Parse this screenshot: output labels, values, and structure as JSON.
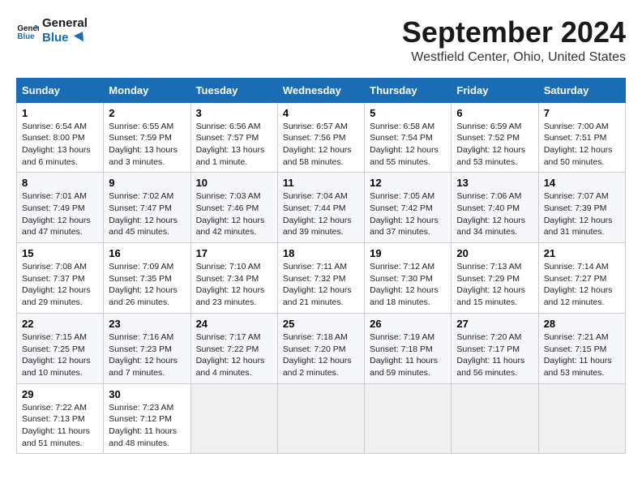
{
  "logo": {
    "line1": "General",
    "line2": "Blue"
  },
  "title": "September 2024",
  "location": "Westfield Center, Ohio, United States",
  "weekdays": [
    "Sunday",
    "Monday",
    "Tuesday",
    "Wednesday",
    "Thursday",
    "Friday",
    "Saturday"
  ],
  "weeks": [
    [
      {
        "day": "1",
        "sunrise": "6:54 AM",
        "sunset": "8:00 PM",
        "daylight": "13 hours and 6 minutes."
      },
      {
        "day": "2",
        "sunrise": "6:55 AM",
        "sunset": "7:59 PM",
        "daylight": "13 hours and 3 minutes."
      },
      {
        "day": "3",
        "sunrise": "6:56 AM",
        "sunset": "7:57 PM",
        "daylight": "13 hours and 1 minute."
      },
      {
        "day": "4",
        "sunrise": "6:57 AM",
        "sunset": "7:56 PM",
        "daylight": "12 hours and 58 minutes."
      },
      {
        "day": "5",
        "sunrise": "6:58 AM",
        "sunset": "7:54 PM",
        "daylight": "12 hours and 55 minutes."
      },
      {
        "day": "6",
        "sunrise": "6:59 AM",
        "sunset": "7:52 PM",
        "daylight": "12 hours and 53 minutes."
      },
      {
        "day": "7",
        "sunrise": "7:00 AM",
        "sunset": "7:51 PM",
        "daylight": "12 hours and 50 minutes."
      }
    ],
    [
      {
        "day": "8",
        "sunrise": "7:01 AM",
        "sunset": "7:49 PM",
        "daylight": "12 hours and 47 minutes."
      },
      {
        "day": "9",
        "sunrise": "7:02 AM",
        "sunset": "7:47 PM",
        "daylight": "12 hours and 45 minutes."
      },
      {
        "day": "10",
        "sunrise": "7:03 AM",
        "sunset": "7:46 PM",
        "daylight": "12 hours and 42 minutes."
      },
      {
        "day": "11",
        "sunrise": "7:04 AM",
        "sunset": "7:44 PM",
        "daylight": "12 hours and 39 minutes."
      },
      {
        "day": "12",
        "sunrise": "7:05 AM",
        "sunset": "7:42 PM",
        "daylight": "12 hours and 37 minutes."
      },
      {
        "day": "13",
        "sunrise": "7:06 AM",
        "sunset": "7:40 PM",
        "daylight": "12 hours and 34 minutes."
      },
      {
        "day": "14",
        "sunrise": "7:07 AM",
        "sunset": "7:39 PM",
        "daylight": "12 hours and 31 minutes."
      }
    ],
    [
      {
        "day": "15",
        "sunrise": "7:08 AM",
        "sunset": "7:37 PM",
        "daylight": "12 hours and 29 minutes."
      },
      {
        "day": "16",
        "sunrise": "7:09 AM",
        "sunset": "7:35 PM",
        "daylight": "12 hours and 26 minutes."
      },
      {
        "day": "17",
        "sunrise": "7:10 AM",
        "sunset": "7:34 PM",
        "daylight": "12 hours and 23 minutes."
      },
      {
        "day": "18",
        "sunrise": "7:11 AM",
        "sunset": "7:32 PM",
        "daylight": "12 hours and 21 minutes."
      },
      {
        "day": "19",
        "sunrise": "7:12 AM",
        "sunset": "7:30 PM",
        "daylight": "12 hours and 18 minutes."
      },
      {
        "day": "20",
        "sunrise": "7:13 AM",
        "sunset": "7:29 PM",
        "daylight": "12 hours and 15 minutes."
      },
      {
        "day": "21",
        "sunrise": "7:14 AM",
        "sunset": "7:27 PM",
        "daylight": "12 hours and 12 minutes."
      }
    ],
    [
      {
        "day": "22",
        "sunrise": "7:15 AM",
        "sunset": "7:25 PM",
        "daylight": "12 hours and 10 minutes."
      },
      {
        "day": "23",
        "sunrise": "7:16 AM",
        "sunset": "7:23 PM",
        "daylight": "12 hours and 7 minutes."
      },
      {
        "day": "24",
        "sunrise": "7:17 AM",
        "sunset": "7:22 PM",
        "daylight": "12 hours and 4 minutes."
      },
      {
        "day": "25",
        "sunrise": "7:18 AM",
        "sunset": "7:20 PM",
        "daylight": "12 hours and 2 minutes."
      },
      {
        "day": "26",
        "sunrise": "7:19 AM",
        "sunset": "7:18 PM",
        "daylight": "11 hours and 59 minutes."
      },
      {
        "day": "27",
        "sunrise": "7:20 AM",
        "sunset": "7:17 PM",
        "daylight": "11 hours and 56 minutes."
      },
      {
        "day": "28",
        "sunrise": "7:21 AM",
        "sunset": "7:15 PM",
        "daylight": "11 hours and 53 minutes."
      }
    ],
    [
      {
        "day": "29",
        "sunrise": "7:22 AM",
        "sunset": "7:13 PM",
        "daylight": "11 hours and 51 minutes."
      },
      {
        "day": "30",
        "sunrise": "7:23 AM",
        "sunset": "7:12 PM",
        "daylight": "11 hours and 48 minutes."
      },
      null,
      null,
      null,
      null,
      null
    ]
  ]
}
